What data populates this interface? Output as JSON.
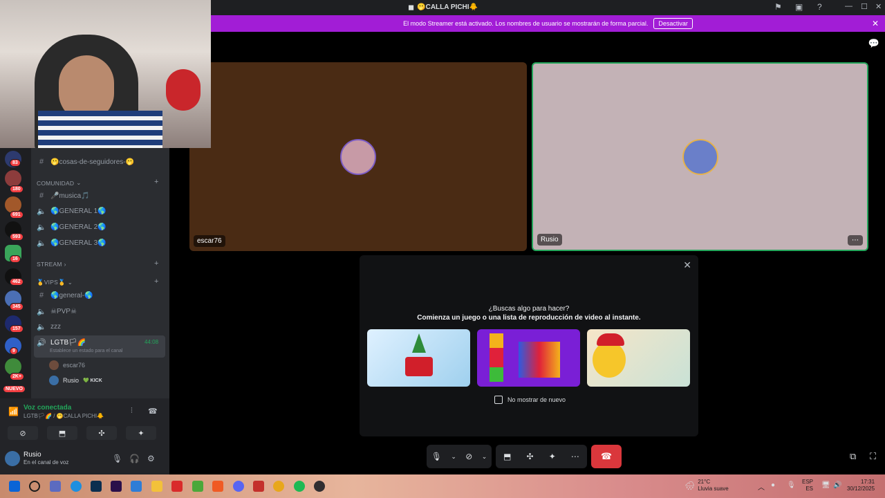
{
  "titlebar": {
    "title": "🫢CALLA PICHI🐥"
  },
  "banner": {
    "message": "El modo Streamer está activado. Los nombres de usuario se mostrarán de forma parcial.",
    "button": "Desactivar"
  },
  "rail_badges": [
    "83",
    "180",
    "691",
    "593",
    "16",
    "462",
    "345",
    "157",
    "9",
    "2K+",
    "NUEVO"
  ],
  "channels": {
    "top": "🫢cosas-de-seguidores-🫢",
    "categories": {
      "comunidad": "COMUNIDAD",
      "stream": "STREAM",
      "vips": "🥇VIPS🥇"
    },
    "comunidad_items": [
      "🎤musica🎵",
      "🌎GENERAL 1🌎",
      "🌎GENERAL 2🌎",
      "🌎GENERAL 3🌎"
    ],
    "vips_items": [
      "🌎general-🌎",
      "☠PVP☠",
      "zzz"
    ],
    "active": {
      "name": "LGTB🏳🌈",
      "timer": "44:08",
      "status": "Establece un estado para el canal"
    },
    "members": [
      "escar76",
      "Rusio"
    ],
    "member_tag": "💚 KICK"
  },
  "voice": {
    "status": "Voz conectada",
    "channel": "LGTB🏳🌈 / 🫢CALLA PICHI🐥"
  },
  "user": {
    "name": "Rusio",
    "status": "En el canal de voz"
  },
  "stage": {
    "tiles": [
      {
        "name": "escar76",
        "color": "#4a2b14"
      },
      {
        "name": "Rusio",
        "color": "#c3b2b6"
      }
    ],
    "activity": {
      "line1": "¿Buscas algo para hacer?",
      "line2": "Comienza un juego o una lista de reproducción de video al instante.",
      "checkbox": "No mostrar de nuevo"
    }
  },
  "taskbar": {
    "weather_temp": "21°C",
    "weather_desc": "Lluvia suave",
    "lang1": "ESP",
    "lang2": "ES",
    "time": "17:31",
    "date": "30/12/2025"
  },
  "colors": {
    "accent": "#a21dd6",
    "connected": "#23a55a",
    "end_call": "#da373c"
  }
}
